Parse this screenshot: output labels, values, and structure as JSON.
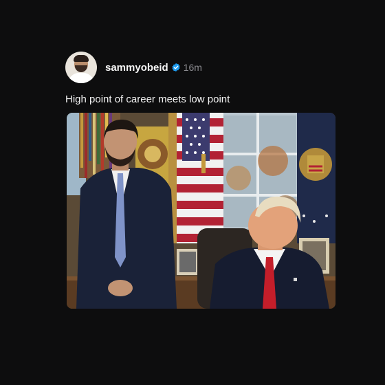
{
  "post": {
    "username": "sammyobeid",
    "verified": true,
    "timestamp": "16m",
    "caption": "High point of career meets low point",
    "colors": {
      "background": "#0d0d0e",
      "verified_badge": "#1d9bf0",
      "timestamp": "#8d8d92"
    },
    "icons": {
      "verified": "verified-badge-icon"
    }
  }
}
